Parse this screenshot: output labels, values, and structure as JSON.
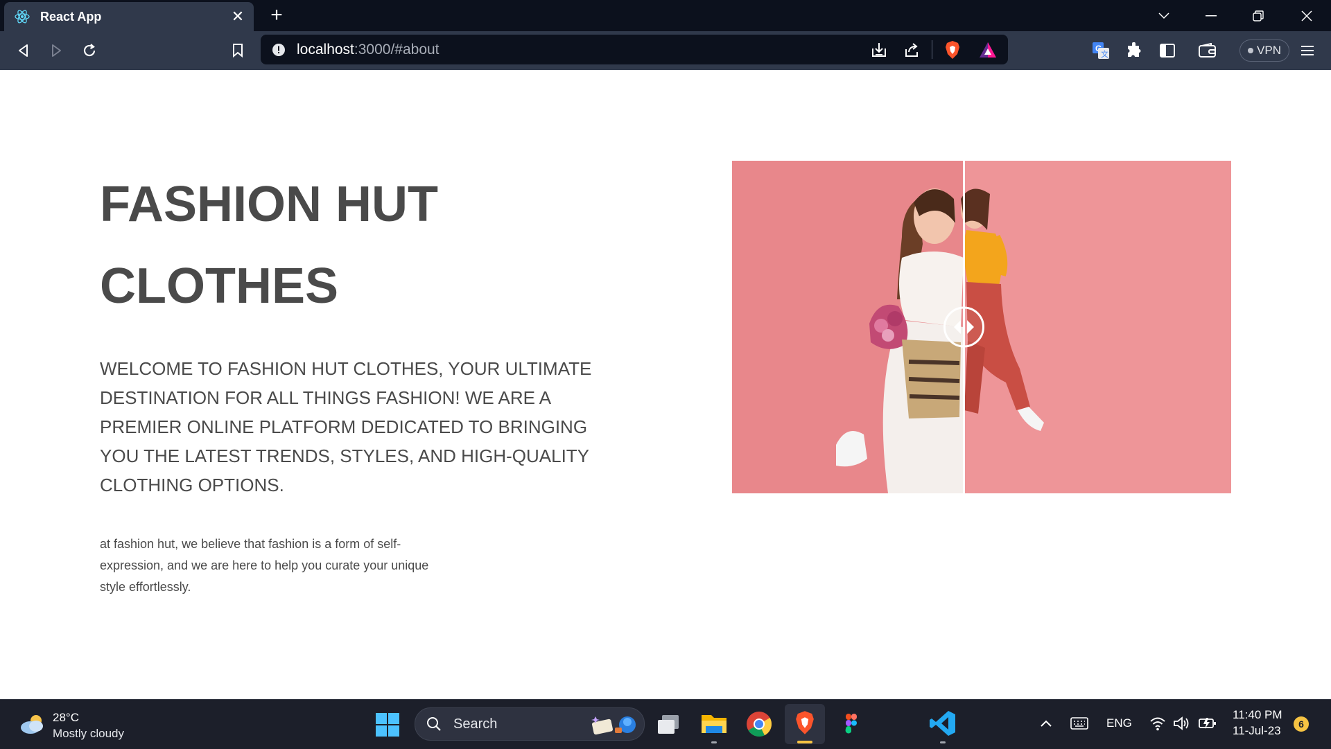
{
  "browser": {
    "tab_title": "React App",
    "url_host": "localhost",
    "url_rest": ":3000/#about",
    "vpn_label": "VPN"
  },
  "page": {
    "title_line1": "FASHION HUT",
    "title_line2": "CLOTHES",
    "lead": "WELCOME TO FASHION HUT CLOTHES, YOUR ULTIMATE DESTINATION FOR ALL THINGS FASHION! WE ARE A PREMIER ONLINE PLATFORM DEDICATED TO BRINGING YOU THE LATEST TRENDS, STYLES, AND HIGH-QUALITY CLOTHING OPTIONS.",
    "body": "at fashion hut, we believe that fashion is a form of self-expression, and we are here to help you curate your unique style effortlessly.",
    "compare_slider_position": 0.465
  },
  "taskbar": {
    "weather_temp": "28°C",
    "weather_desc": "Mostly cloudy",
    "search_label": "Search",
    "lang": "ENG",
    "time": "11:40 PM",
    "date": "11-Jul-23",
    "notif_count": "6"
  },
  "colors": {
    "tab_bg": "#0c111d",
    "toolbar_bg": "#30394b",
    "text_heading": "#4a4a4a",
    "image_pink": "#e8878b",
    "brave_orange": "#fb542b"
  }
}
